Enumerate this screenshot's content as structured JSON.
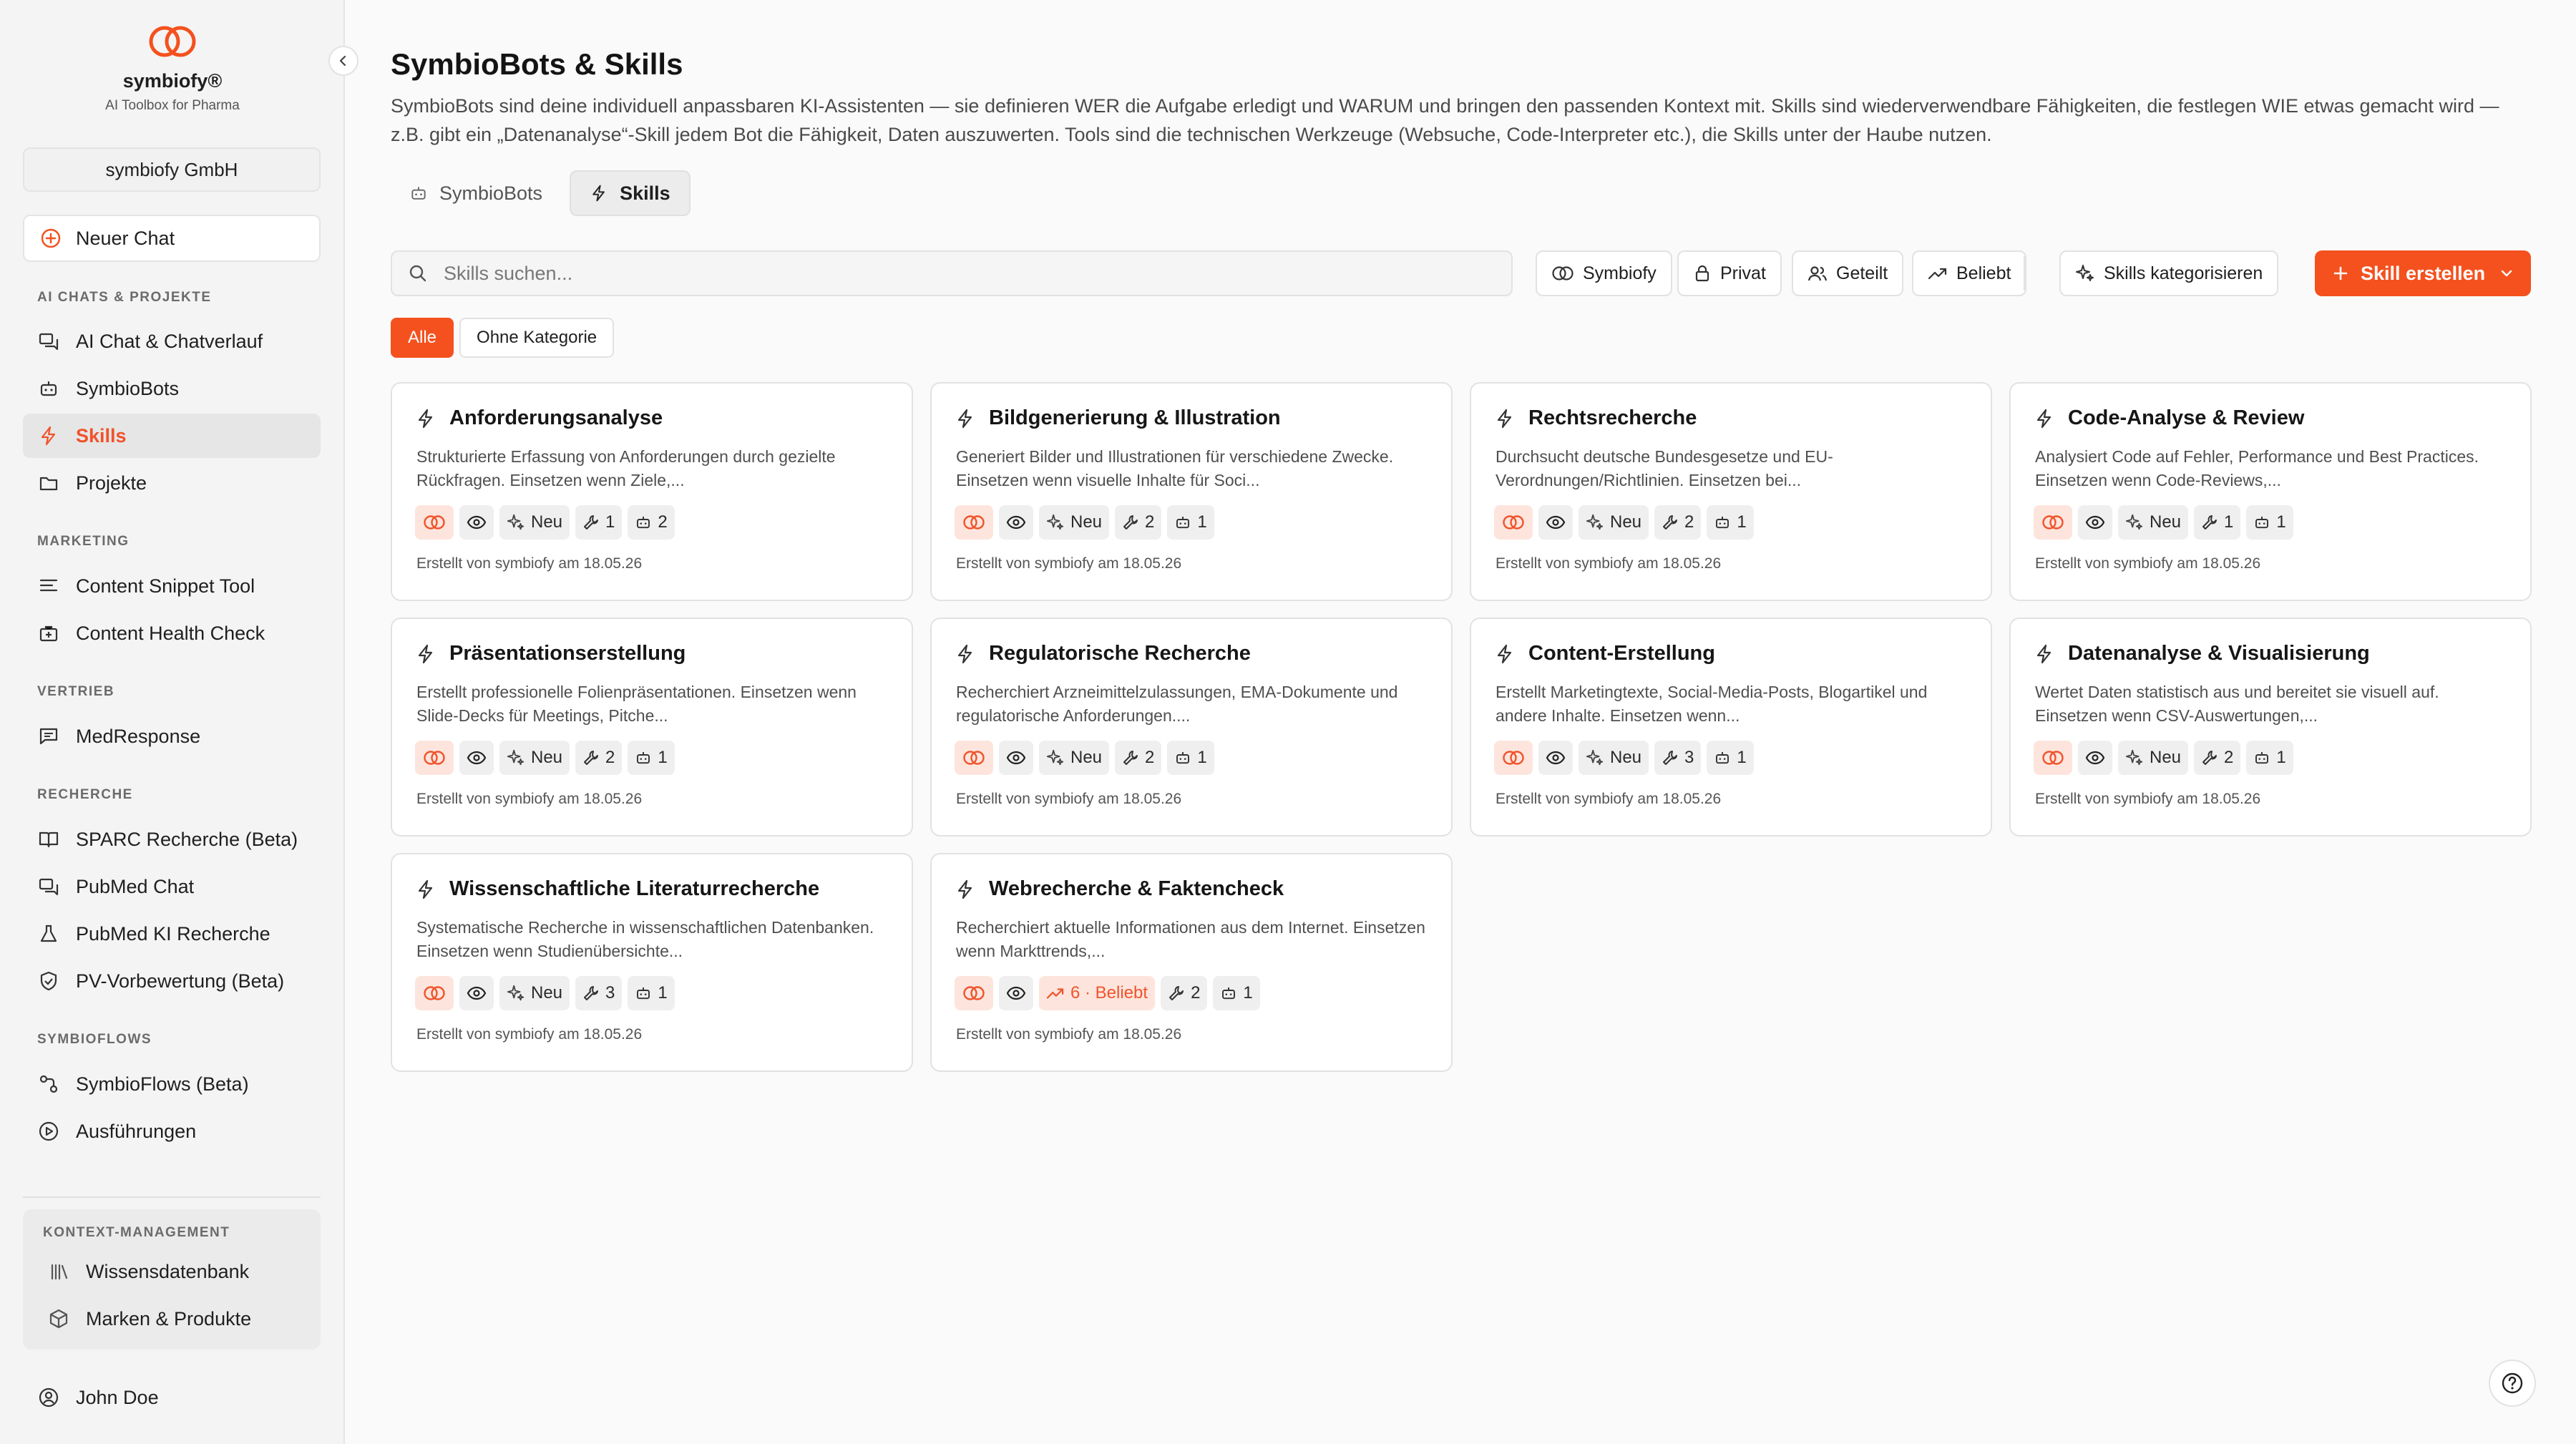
{
  "brand": {
    "name": "symbiofy®",
    "tagline": "AI Toolbox for Pharma",
    "org": "symbiofy GmbH",
    "accent": "#f4511e"
  },
  "sidebar": {
    "new_chat": "Neuer Chat",
    "groups": [
      {
        "title": "AI CHATS & PROJEKTE",
        "items": [
          {
            "label": "AI Chat & Chatverlauf",
            "icon": "chat-history-icon"
          },
          {
            "label": "SymbioBots",
            "icon": "bot-icon"
          },
          {
            "label": "Skills",
            "icon": "bolt-icon",
            "active": true
          },
          {
            "label": "Projekte",
            "icon": "folder-icon"
          }
        ]
      },
      {
        "title": "MARKETING",
        "items": [
          {
            "label": "Content Snippet Tool",
            "icon": "align-left-icon"
          },
          {
            "label": "Content Health Check",
            "icon": "medical-bag-icon"
          }
        ]
      },
      {
        "title": "VERTRIEB",
        "items": [
          {
            "label": "MedResponse",
            "icon": "message-square-icon"
          }
        ]
      },
      {
        "title": "RECHERCHE",
        "items": [
          {
            "label": "SPARC Recherche (Beta)",
            "icon": "book-open-icon"
          },
          {
            "label": "PubMed Chat",
            "icon": "chat-icon"
          },
          {
            "label": "PubMed KI Recherche",
            "icon": "flask-icon"
          },
          {
            "label": "PV-Vorbewertung (Beta)",
            "icon": "shield-check-icon"
          }
        ]
      },
      {
        "title": "SYMBIOFLOWS",
        "items": [
          {
            "label": "SymbioFlows (Beta)",
            "icon": "workflow-icon"
          },
          {
            "label": "Ausführungen",
            "icon": "play-circle-icon"
          }
        ]
      }
    ],
    "kontext": {
      "title": "KONTEXT-MANAGEMENT",
      "items": [
        {
          "label": "Wissensdatenbank",
          "icon": "library-icon"
        },
        {
          "label": "Marken & Produkte",
          "icon": "package-icon"
        }
      ]
    },
    "user": "John Doe"
  },
  "main": {
    "title": "SymbioBots & Skills",
    "description": "SymbioBots sind deine individuell anpassbaren KI-Assistenten — sie definieren WER die Aufgabe erledigt und WARUM und bringen den passenden Kontext mit. Skills sind wiederverwendbare Fähigkeiten, die festlegen WIE etwas gemacht wird — z.B. gibt ein „Datenanalyse“-Skill jedem Bot die Fähigkeit, Daten auszuwerten. Tools sind die technischen Werkzeuge (Websuche, Code-Interpreter etc.), die Skills unter der Haube nutzen.",
    "tabs": [
      {
        "label": "SymbioBots",
        "active": false
      },
      {
        "label": "Skills",
        "active": true
      }
    ],
    "search_placeholder": "Skills suchen...",
    "filters": [
      "Symbiofy",
      "Privat",
      "Geteilt",
      "Beliebt"
    ],
    "categorize": "Skills kategorisieren",
    "create": "Skill erstellen",
    "chips": [
      {
        "label": "Alle",
        "active": true
      },
      {
        "label": "Ohne Kategorie",
        "active": false
      }
    ]
  },
  "cards": [
    {
      "title": "Anforderungsanalyse",
      "desc": "Strukturierte Erfassung von Anforderungen durch gezielte Rückfragen. Einsetzen wenn Ziele,...",
      "status": "Neu",
      "tools": "1",
      "bots": "2",
      "footer": "Erstellt von symbiofy am 18.05.26"
    },
    {
      "title": "Bildgenerierung & Illustration",
      "desc": "Generiert Bilder und Illustrationen für verschiedene Zwecke. Einsetzen wenn visuelle Inhalte für Soci...",
      "status": "Neu",
      "tools": "2",
      "bots": "1",
      "footer": "Erstellt von symbiofy am 18.05.26"
    },
    {
      "title": "Rechtsrecherche",
      "desc": "Durchsucht deutsche Bundesgesetze und EU-Verordnungen/Richtlinien. Einsetzen bei...",
      "status": "Neu",
      "tools": "2",
      "bots": "1",
      "footer": "Erstellt von symbiofy am 18.05.26"
    },
    {
      "title": "Code-Analyse & Review",
      "desc": "Analysiert Code auf Fehler, Performance und Best Practices. Einsetzen wenn Code-Reviews,...",
      "status": "Neu",
      "tools": "1",
      "bots": "1",
      "footer": "Erstellt von symbiofy am 18.05.26"
    },
    {
      "title": "Präsentationserstellung",
      "desc": "Erstellt professionelle Folienpräsentationen. Einsetzen wenn Slide-Decks für Meetings, Pitche...",
      "status": "Neu",
      "tools": "2",
      "bots": "1",
      "footer": "Erstellt von symbiofy am 18.05.26"
    },
    {
      "title": "Regulatorische Recherche",
      "desc": "Recherchiert Arzneimittelzulassungen, EMA-Dokumente und regulatorische Anforderungen....",
      "status": "Neu",
      "tools": "2",
      "bots": "1",
      "footer": "Erstellt von symbiofy am 18.05.26"
    },
    {
      "title": "Content-Erstellung",
      "desc": "Erstellt Marketingtexte, Social-Media-Posts, Blogartikel und andere Inhalte. Einsetzen wenn...",
      "status": "Neu",
      "tools": "3",
      "bots": "1",
      "footer": "Erstellt von symbiofy am 18.05.26"
    },
    {
      "title": "Datenanalyse & Visualisierung",
      "desc": "Wertet Daten statistisch aus und bereitet sie visuell auf. Einsetzen wenn CSV-Auswertungen,...",
      "status": "Neu",
      "tools": "2",
      "bots": "1",
      "footer": "Erstellt von symbiofy am 18.05.26"
    },
    {
      "title": "Wissenschaftliche Literaturrecherche",
      "desc": "Systematische Recherche in wissenschaftlichen Datenbanken. Einsetzen wenn Studienübersichte...",
      "status": "Neu",
      "tools": "3",
      "bots": "1",
      "footer": "Erstellt von symbiofy am 18.05.26"
    },
    {
      "title": "Webrecherche & Faktencheck",
      "desc": "Recherchiert aktuelle Informationen aus dem Internet. Einsetzen wenn Markttrends,...",
      "status": "6 · Beliebt",
      "popular": true,
      "tools": "2",
      "bots": "1",
      "footer": "Erstellt von symbiofy am 18.05.26"
    }
  ]
}
